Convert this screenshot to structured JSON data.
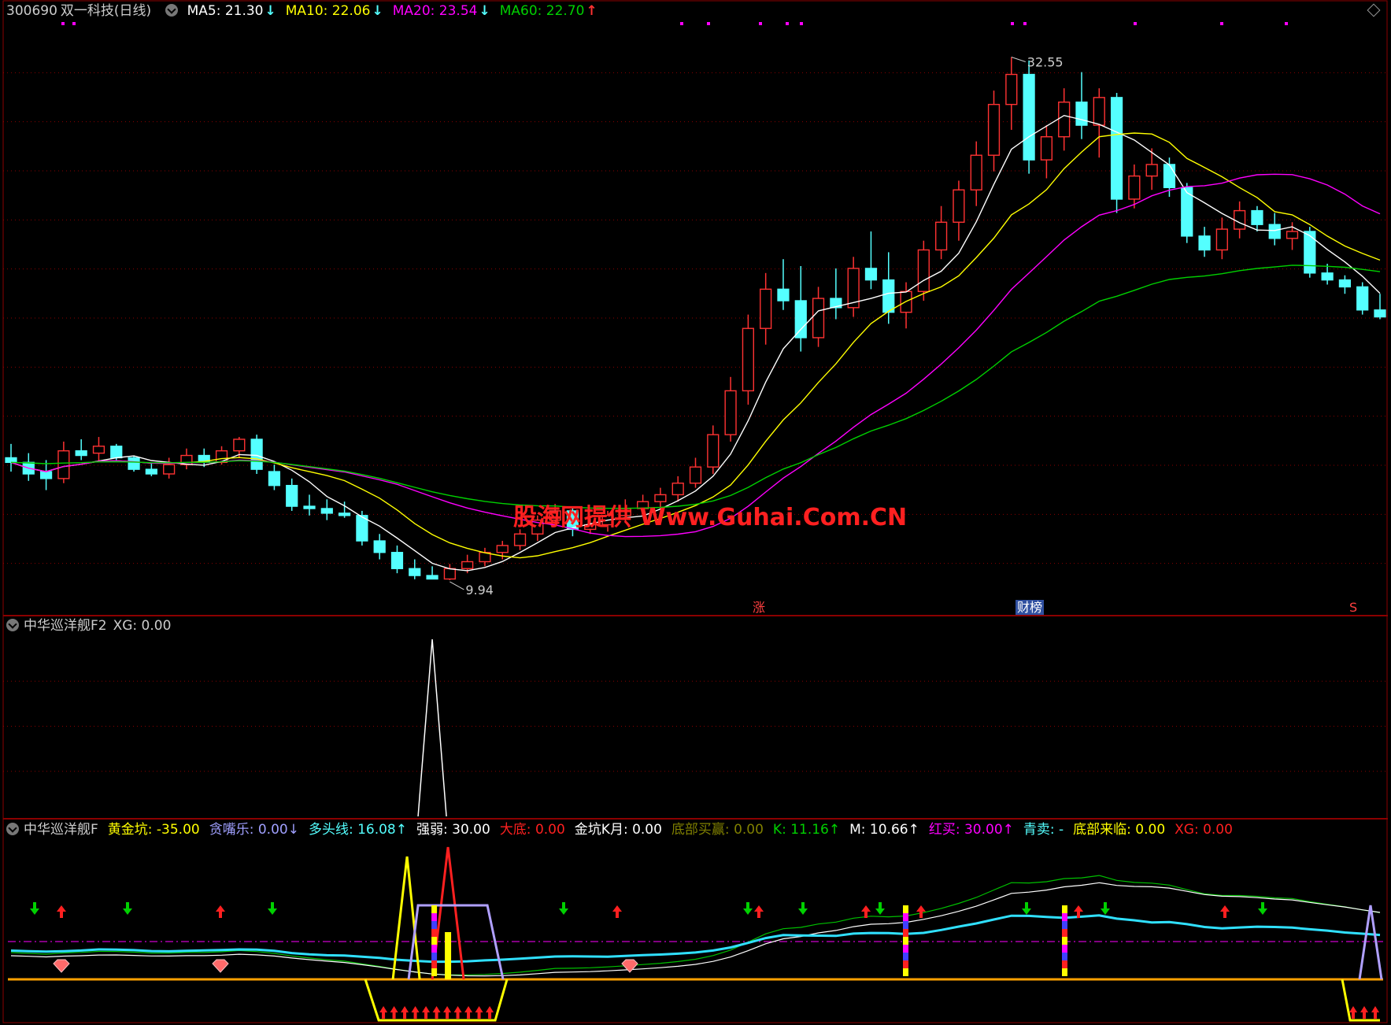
{
  "stock": {
    "code": "300690",
    "name": "双一科技",
    "period": "(日线)"
  },
  "colors": {
    "up": "#ff3232",
    "down": "#54ffff",
    "ma5": "#ffffff",
    "ma10": "#ffff00",
    "ma20": "#ff00ff",
    "ma60": "#00d000",
    "grid": "#8b0000"
  },
  "main_header": [
    {
      "label": "MA5: 21.30",
      "arrow": "↓",
      "color": "#ffffff",
      "arrow_color": "#54ffff"
    },
    {
      "label": "MA10: 22.06",
      "arrow": "↓",
      "color": "#ffff00",
      "arrow_color": "#54ffff"
    },
    {
      "label": "MA20: 23.54",
      "arrow": "↓",
      "color": "#ff00ff",
      "arrow_color": "#54ffff"
    },
    {
      "label": "MA60: 22.70",
      "arrow": "↑",
      "color": "#00d000",
      "arrow_color": "#ff3232"
    }
  ],
  "price_annotations": {
    "high": "32.55",
    "low": "9.94"
  },
  "watermark": "股海网提供 Www.Guhai.Com.CN",
  "badges": {
    "zhang": "涨",
    "caibang": "财榜",
    "s": "S"
  },
  "panel2_header": {
    "name": "中华巡洋舰F2",
    "xg": "XG: 0.00"
  },
  "panel3_header": [
    {
      "label": "中华巡洋舰F",
      "color": "#cccccc"
    },
    {
      "label": "黄金坑: -35.00",
      "color": "#ffff00"
    },
    {
      "label": "贪嘴乐: 0.00↓",
      "color": "#a0a0ff"
    },
    {
      "label": "多头线: 16.08↑",
      "color": "#54ffff"
    },
    {
      "label": "强弱: 30.00",
      "color": "#ffffff"
    },
    {
      "label": "大底: 0.00",
      "color": "#ff2020"
    },
    {
      "label": "金坑K月: 0.00",
      "color": "#ffffff"
    },
    {
      "label": "底部买赢: 0.00",
      "color": "#808000"
    },
    {
      "label": "K: 11.16↑",
      "color": "#00d000"
    },
    {
      "label": "M: 10.66↑",
      "color": "#ffffff"
    },
    {
      "label": "红买: 30.00↑",
      "color": "#ff00ff"
    },
    {
      "label": "青卖: -",
      "color": "#54ffff"
    },
    {
      "label": "底部来临: 0.00",
      "color": "#ffff00"
    },
    {
      "label": "XG: 0.00",
      "color": "#ff2020"
    }
  ],
  "chart_data": {
    "type": "candlestick",
    "price_range": [
      8.5,
      34.0
    ],
    "candles": [
      [
        15.2,
        15.8,
        14.6,
        15.0
      ],
      [
        15.0,
        15.4,
        14.2,
        14.5
      ],
      [
        14.6,
        15.1,
        13.8,
        14.3
      ],
      [
        14.3,
        15.9,
        14.1,
        15.5
      ],
      [
        15.5,
        16.0,
        15.1,
        15.3
      ],
      [
        15.4,
        16.1,
        15.0,
        15.7
      ],
      [
        15.7,
        15.8,
        15.1,
        15.2
      ],
      [
        15.2,
        15.3,
        14.6,
        14.7
      ],
      [
        14.7,
        15.0,
        14.4,
        14.5
      ],
      [
        14.5,
        15.2,
        14.3,
        14.9
      ],
      [
        14.9,
        15.6,
        14.7,
        15.3
      ],
      [
        15.3,
        15.6,
        14.8,
        15.0
      ],
      [
        15.0,
        15.7,
        14.9,
        15.5
      ],
      [
        15.5,
        16.1,
        15.2,
        16.0
      ],
      [
        16.0,
        16.2,
        14.5,
        14.7
      ],
      [
        14.6,
        14.9,
        13.8,
        14.0
      ],
      [
        14.0,
        14.3,
        12.9,
        13.1
      ],
      [
        13.1,
        13.6,
        12.7,
        13.0
      ],
      [
        13.0,
        13.4,
        12.5,
        12.8
      ],
      [
        12.8,
        13.3,
        12.6,
        12.7
      ],
      [
        12.7,
        12.9,
        11.4,
        11.6
      ],
      [
        11.6,
        11.9,
        10.8,
        11.1
      ],
      [
        11.1,
        11.4,
        10.2,
        10.4
      ],
      [
        10.4,
        10.8,
        9.94,
        10.1
      ],
      [
        10.1,
        10.5,
        9.94,
        9.95
      ],
      [
        9.95,
        10.6,
        9.9,
        10.4
      ],
      [
        10.4,
        11.0,
        10.2,
        10.7
      ],
      [
        10.7,
        11.3,
        10.5,
        11.1
      ],
      [
        11.1,
        11.6,
        10.8,
        11.4
      ],
      [
        11.4,
        12.1,
        11.2,
        11.9
      ],
      [
        11.9,
        12.7,
        11.6,
        12.5
      ],
      [
        12.5,
        13.2,
        12.2,
        12.9
      ],
      [
        12.9,
        13.1,
        11.8,
        12.1
      ],
      [
        12.1,
        12.6,
        11.9,
        12.3
      ],
      [
        12.3,
        12.9,
        12.0,
        12.7
      ],
      [
        12.7,
        13.4,
        12.4,
        13.0
      ],
      [
        13.0,
        13.6,
        12.8,
        13.3
      ],
      [
        13.3,
        13.9,
        13.0,
        13.6
      ],
      [
        13.6,
        14.4,
        13.3,
        14.1
      ],
      [
        14.1,
        15.2,
        13.9,
        14.8
      ],
      [
        14.8,
        16.6,
        14.5,
        16.2
      ],
      [
        16.2,
        18.7,
        15.9,
        18.1
      ],
      [
        18.1,
        21.4,
        17.5,
        20.8
      ],
      [
        20.8,
        23.2,
        20.1,
        22.5
      ],
      [
        22.5,
        23.8,
        21.6,
        22.0
      ],
      [
        22.0,
        23.5,
        19.8,
        20.4
      ],
      [
        20.4,
        22.6,
        20.0,
        22.1
      ],
      [
        22.1,
        23.4,
        21.2,
        21.7
      ],
      [
        21.7,
        23.9,
        21.3,
        23.4
      ],
      [
        23.4,
        25.0,
        22.5,
        22.9
      ],
      [
        22.9,
        24.1,
        21.0,
        21.5
      ],
      [
        21.5,
        22.8,
        20.8,
        22.4
      ],
      [
        22.4,
        24.6,
        22.0,
        24.2
      ],
      [
        24.2,
        26.1,
        23.8,
        25.4
      ],
      [
        25.4,
        27.2,
        24.6,
        26.8
      ],
      [
        26.8,
        28.9,
        26.1,
        28.3
      ],
      [
        28.3,
        31.1,
        27.6,
        30.5
      ],
      [
        30.5,
        32.55,
        29.4,
        31.8
      ],
      [
        31.8,
        32.4,
        27.5,
        28.1
      ],
      [
        28.1,
        29.6,
        27.3,
        29.1
      ],
      [
        29.1,
        31.2,
        28.5,
        30.6
      ],
      [
        30.6,
        31.9,
        29.0,
        29.6
      ],
      [
        29.6,
        31.2,
        28.2,
        30.8
      ],
      [
        30.8,
        31.0,
        25.8,
        26.4
      ],
      [
        26.4,
        27.9,
        26.0,
        27.4
      ],
      [
        27.4,
        28.6,
        26.8,
        27.9
      ],
      [
        27.9,
        28.2,
        26.5,
        26.9
      ],
      [
        26.9,
        27.1,
        24.5,
        24.8
      ],
      [
        24.8,
        25.2,
        23.9,
        24.2
      ],
      [
        24.2,
        25.6,
        23.8,
        25.1
      ],
      [
        25.1,
        26.3,
        24.7,
        25.9
      ],
      [
        25.9,
        26.1,
        25.0,
        25.3
      ],
      [
        25.3,
        25.8,
        24.4,
        24.7
      ],
      [
        24.7,
        25.4,
        24.2,
        25.0
      ],
      [
        25.0,
        25.2,
        23.0,
        23.2
      ],
      [
        23.2,
        23.6,
        22.7,
        22.9
      ],
      [
        22.9,
        23.1,
        22.3,
        22.6
      ],
      [
        22.6,
        22.8,
        21.4,
        21.6
      ],
      [
        21.6,
        22.3,
        21.2,
        21.3
      ]
    ],
    "ma_last": {
      "MA5": 21.3,
      "MA10": 22.06,
      "MA20": 23.54,
      "MA60": 22.7
    },
    "xg_spike": {
      "index": 24,
      "value": 1
    }
  }
}
